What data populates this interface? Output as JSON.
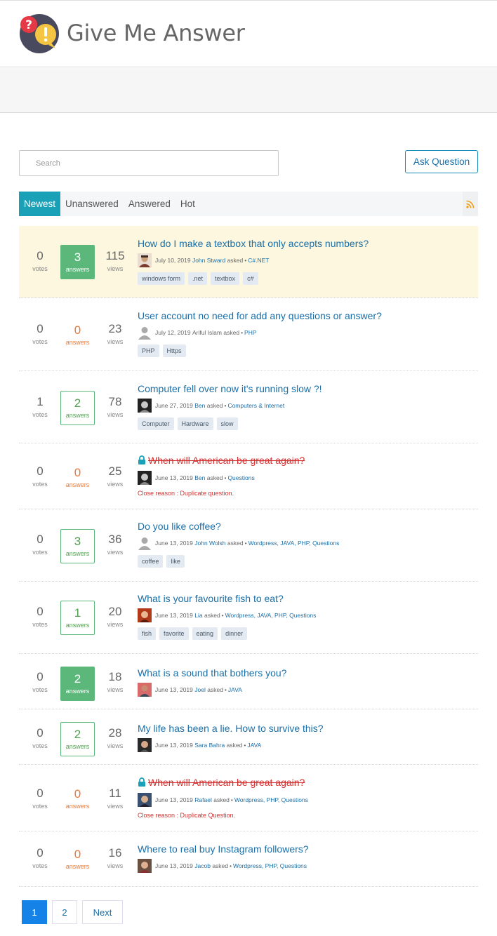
{
  "site": {
    "title": "Give Me Answer"
  },
  "search": {
    "placeholder": "Search"
  },
  "ask_button": "Ask Question",
  "tabs": [
    "Newest",
    "Unanswered",
    "Answered",
    "Hot"
  ],
  "questions": [
    {
      "votes": "0",
      "votes_label": "votes",
      "answers": "3",
      "answers_label": "answers",
      "views": "115",
      "views_label": "views",
      "title": "How do I make a textbox that only accepts numbers?",
      "date": "July 10, 2019",
      "author": "John Stward",
      "asked": "asked",
      "bullet": "•",
      "categories": "C#.NET",
      "tags": [
        "windows form",
        ".net",
        "textbox",
        "c#"
      ]
    },
    {
      "votes": "0",
      "votes_label": "votes",
      "answers": "0",
      "answers_label": "answers",
      "views": "23",
      "views_label": "views",
      "title": "User account no need for add any questions or answer?",
      "date": "July 12, 2019",
      "author": "Ariful Islam",
      "asked": "asked",
      "bullet": "•",
      "categories": "PHP",
      "tags": [
        "PHP",
        "Https"
      ]
    },
    {
      "votes": "1",
      "votes_label": "votes",
      "answers": "2",
      "answers_label": "answers",
      "views": "78",
      "views_label": "views",
      "title": "Computer fell over now it's running slow ?!",
      "date": "June 27, 2019",
      "author": "Ben",
      "asked": "asked",
      "bullet": "•",
      "categories": "Computers & Internet",
      "tags": [
        "Computer",
        "Hardware",
        "slow"
      ]
    },
    {
      "votes": "0",
      "votes_label": "votes",
      "answers": "0",
      "answers_label": "answers",
      "views": "25",
      "views_label": "views",
      "title": "When will American be great again?",
      "date": "June 13, 2019",
      "author": "Ben",
      "asked": "asked",
      "bullet": "•",
      "categories": "Questions",
      "close_reason": "Close reason : Duplicate question."
    },
    {
      "votes": "0",
      "votes_label": "votes",
      "answers": "3",
      "answers_label": "answers",
      "views": "36",
      "views_label": "views",
      "title": "Do you like coffee?",
      "date": "June 13, 2019",
      "author": "John Wolsh",
      "asked": "asked",
      "bullet": "•",
      "categories": "Wordpress, JAVA, PHP, Questions",
      "tags": [
        "coffee",
        "like"
      ]
    },
    {
      "votes": "0",
      "votes_label": "votes",
      "answers": "1",
      "answers_label": "answers",
      "views": "20",
      "views_label": "views",
      "title": "What is your favourite fish to eat?",
      "date": "June 13, 2019",
      "author": "Lia",
      "asked": "asked",
      "bullet": "•",
      "categories": "Wordpress, JAVA, PHP, Questions",
      "tags": [
        "fish",
        "favorite",
        "eating",
        "dinner"
      ]
    },
    {
      "votes": "0",
      "votes_label": "votes",
      "answers": "2",
      "answers_label": "answers",
      "views": "18",
      "views_label": "views",
      "title": "What is a sound that bothers you?",
      "date": "June 13, 2019",
      "author": "Joel",
      "asked": "asked",
      "bullet": "•",
      "categories": "JAVA"
    },
    {
      "votes": "0",
      "votes_label": "votes",
      "answers": "2",
      "answers_label": "answers",
      "views": "28",
      "views_label": "views",
      "title": "My life has been a lie. How to survive this?",
      "date": "June 13, 2019",
      "author": "Sara Bahra",
      "asked": "asked",
      "bullet": "•",
      "categories": "JAVA"
    },
    {
      "votes": "0",
      "votes_label": "votes",
      "answers": "0",
      "answers_label": "answers",
      "views": "11",
      "views_label": "views",
      "title": "When will American be great again?",
      "date": "June 13, 2019",
      "author": "Rafael",
      "asked": "asked",
      "bullet": "•",
      "categories": "Wordpress, PHP, Questions",
      "close_reason": "Close reason : Duplicate Question."
    },
    {
      "votes": "0",
      "votes_label": "votes",
      "answers": "0",
      "answers_label": "answers",
      "views": "16",
      "views_label": "views",
      "title": "Where to real buy Instagram followers?",
      "date": "June 13, 2019",
      "author": "Jacob",
      "asked": "asked",
      "bullet": "•",
      "categories": "Wordpress, PHP, Questions"
    }
  ],
  "pagination": {
    "pages": [
      "1",
      "2"
    ],
    "next": "Next"
  },
  "colors": {
    "accent": "#1aa1b8",
    "link": "#1a6fa8",
    "answered": "#5cb87a",
    "unanswered": "#e8793a",
    "closed": "#d43030"
  }
}
